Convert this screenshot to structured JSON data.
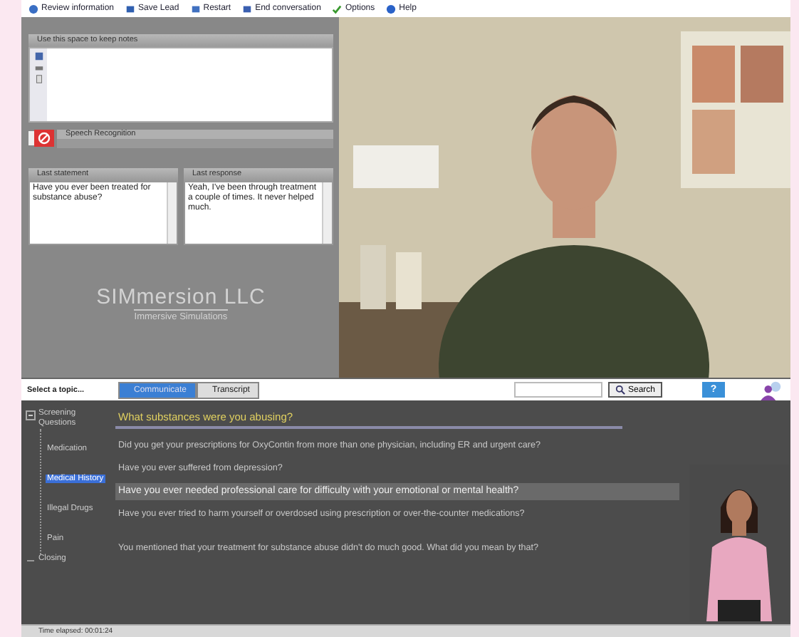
{
  "toolbar": [
    {
      "label": "Review information",
      "kind": "info"
    },
    {
      "label": "Save Lead",
      "kind": "save"
    },
    {
      "label": "Restart",
      "kind": "restart"
    },
    {
      "label": "End conversation",
      "kind": "end"
    },
    {
      "label": "Options",
      "kind": "options"
    },
    {
      "label": "Help",
      "kind": "help"
    }
  ],
  "notes": {
    "title": "Use this space to keep notes"
  },
  "speech": {
    "label": "Speech Recognition"
  },
  "last_statement": {
    "title": "Last statement",
    "text": "Have you ever been treated for substance abuse?"
  },
  "last_response": {
    "title": "Last response",
    "text": "Yeah, I've been through treatment a couple of times.  It never helped much."
  },
  "logo": {
    "name": "SIMmersion LLC",
    "tagline": "Immersive Simulations"
  },
  "topic_label": "Select a topic...",
  "tabs": [
    {
      "label": "Communicate",
      "selected": true
    },
    {
      "label": "Transcript",
      "selected": false
    }
  ],
  "search": {
    "button": "Search"
  },
  "help_button": "?",
  "topics": [
    {
      "label": "Screening Questions",
      "expanded": true,
      "selected": false,
      "children": [
        {
          "label": "Medication",
          "selected": false
        },
        {
          "label": "Medical History",
          "selected": true
        },
        {
          "label": "Illegal Drugs",
          "selected": false
        },
        {
          "label": "Pain",
          "selected": false
        }
      ]
    },
    {
      "label": "Closing",
      "expanded": false,
      "selected": false
    }
  ],
  "questions": [
    {
      "kind": "heading",
      "text": "What substances were you abusing?",
      "selected": false
    },
    {
      "kind": "question",
      "text": "Did you get your prescriptions for OxyContin from more than one physician, including ER and urgent care?",
      "selected": false
    },
    {
      "kind": "question",
      "text": "Have you ever suffered from depression?",
      "selected": false
    },
    {
      "kind": "question",
      "text": "Have you ever needed professional care for difficulty with your emotional or mental health?",
      "selected": true
    },
    {
      "kind": "question",
      "text": "Have you ever tried to harm yourself or overdosed using prescription or over-the-counter medications?",
      "selected": false
    },
    {
      "kind": "followup",
      "text": "You mentioned that your treatment for substance abuse didn't do much good.  What did you mean by that?",
      "selected": false
    }
  ],
  "status_bar": {
    "text": "Time elapsed: 00:01:24"
  }
}
